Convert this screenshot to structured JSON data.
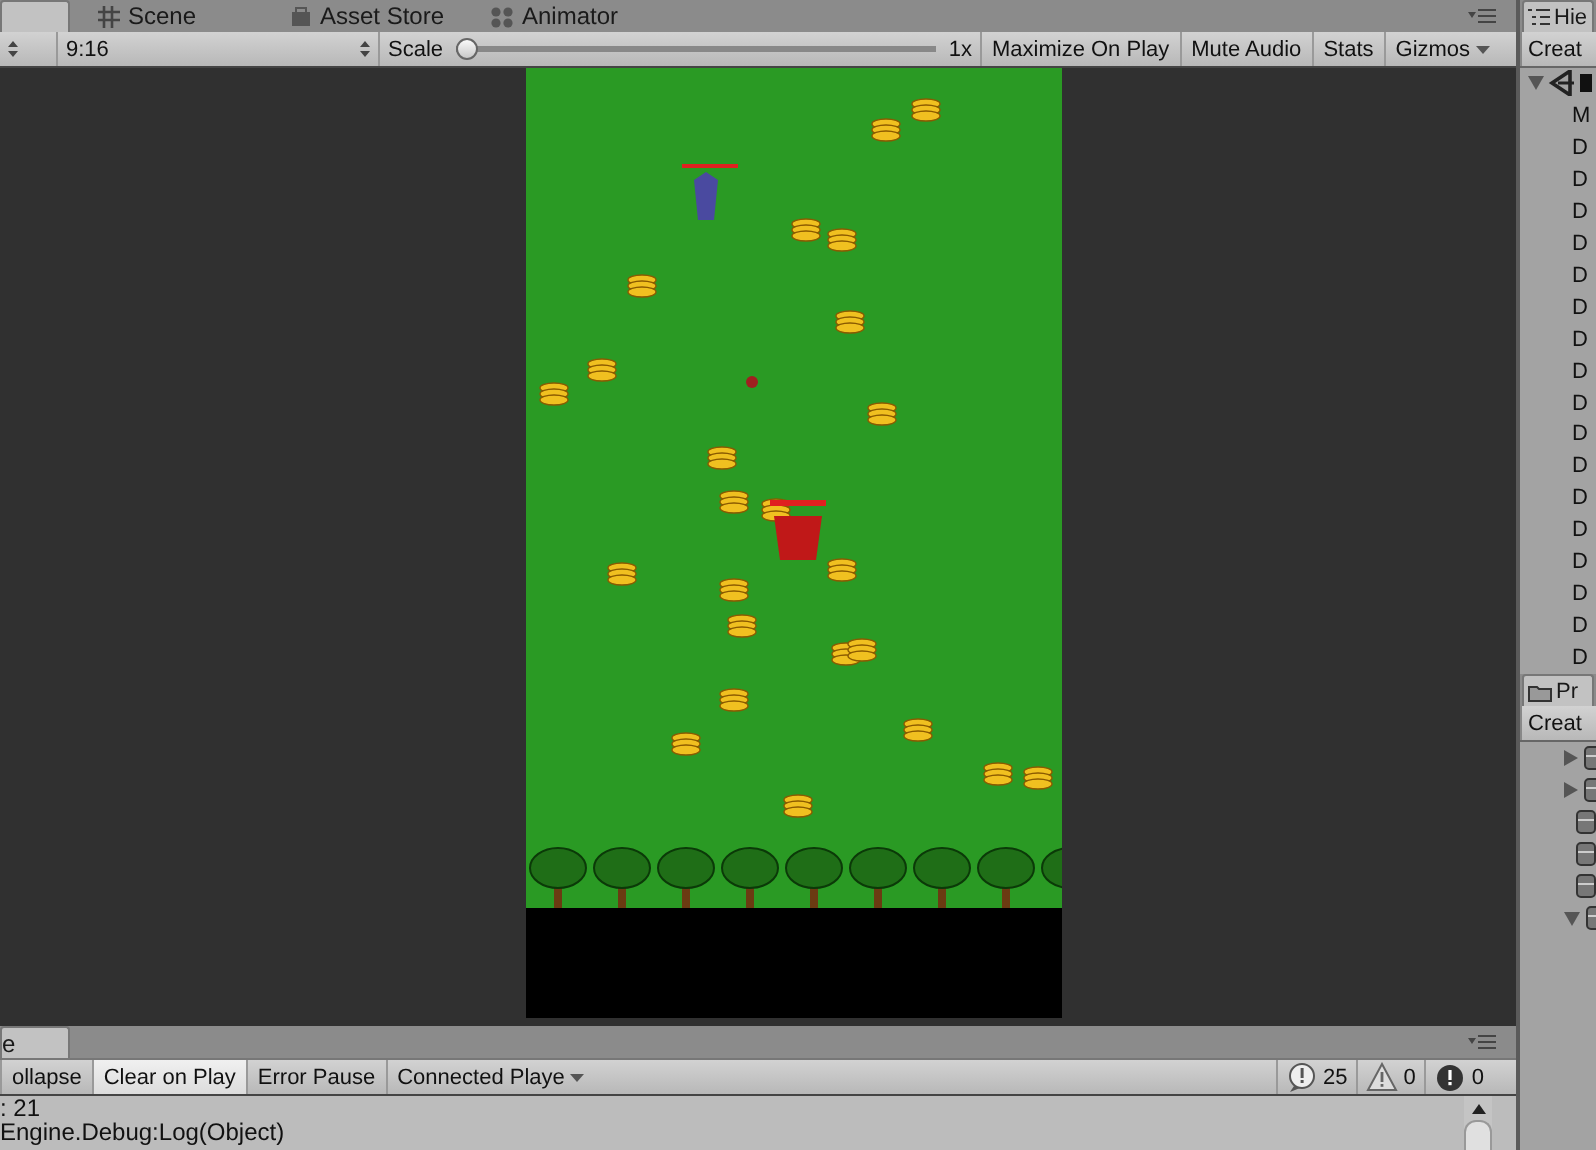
{
  "tabs": [
    {
      "selected": true
    },
    {
      "label": "Scene",
      "selected": false
    },
    {
      "label": "Asset Store",
      "selected": false
    },
    {
      "label": "Animator",
      "selected": false
    }
  ],
  "game_toolbar": {
    "aspect": "9:16",
    "scale_label": "Scale",
    "scale": {
      "level": 0
    },
    "scale_reading": "1x",
    "buttons": [
      {
        "label": "Maximize On Play",
        "on": false
      },
      {
        "label": "Mute Audio",
        "on": false
      },
      {
        "label": "Stats",
        "on": false
      },
      {
        "label": "Gizmos",
        "on": false
      }
    ]
  },
  "console": {
    "tab": "e",
    "toolbar": [
      {
        "label": "ollapse",
        "on": false,
        "kind": "toggle"
      },
      {
        "label": "Clear on Play",
        "on": true,
        "kind": "toggle"
      },
      {
        "label": "Error Pause",
        "on": false,
        "kind": "toggle"
      },
      {
        "label": "Connected Playe",
        "on": false,
        "kind": "dropdown"
      }
    ],
    "counts": [
      {
        "kind": "info",
        "count": "25"
      },
      {
        "kind": "warning",
        "count": "0"
      },
      {
        "kind": "error",
        "count": "0"
      }
    ],
    "lines": [
      ": 21",
      "Engine.Debug:Log(Object)"
    ]
  },
  "hierarchy": {
    "tab": "Hie",
    "create": "Creat",
    "root": {
      "expanded": true
    },
    "items": [
      "M",
      "D",
      "D",
      "D",
      "D",
      "D",
      "D",
      "D",
      "D",
      "D",
      "D",
      "D",
      "D",
      "D",
      "D",
      "D",
      "D",
      "D"
    ]
  },
  "project": {
    "tab": "Pr",
    "create": "Creat",
    "items": [
      {
        "kind": "group",
        "expanded": false
      },
      {
        "kind": "group",
        "expanded": false
      },
      {
        "kind": "leaf"
      },
      {
        "kind": "leaf"
      },
      {
        "kind": "leaf"
      },
      {
        "kind": "group",
        "expanded": true
      }
    ]
  }
}
